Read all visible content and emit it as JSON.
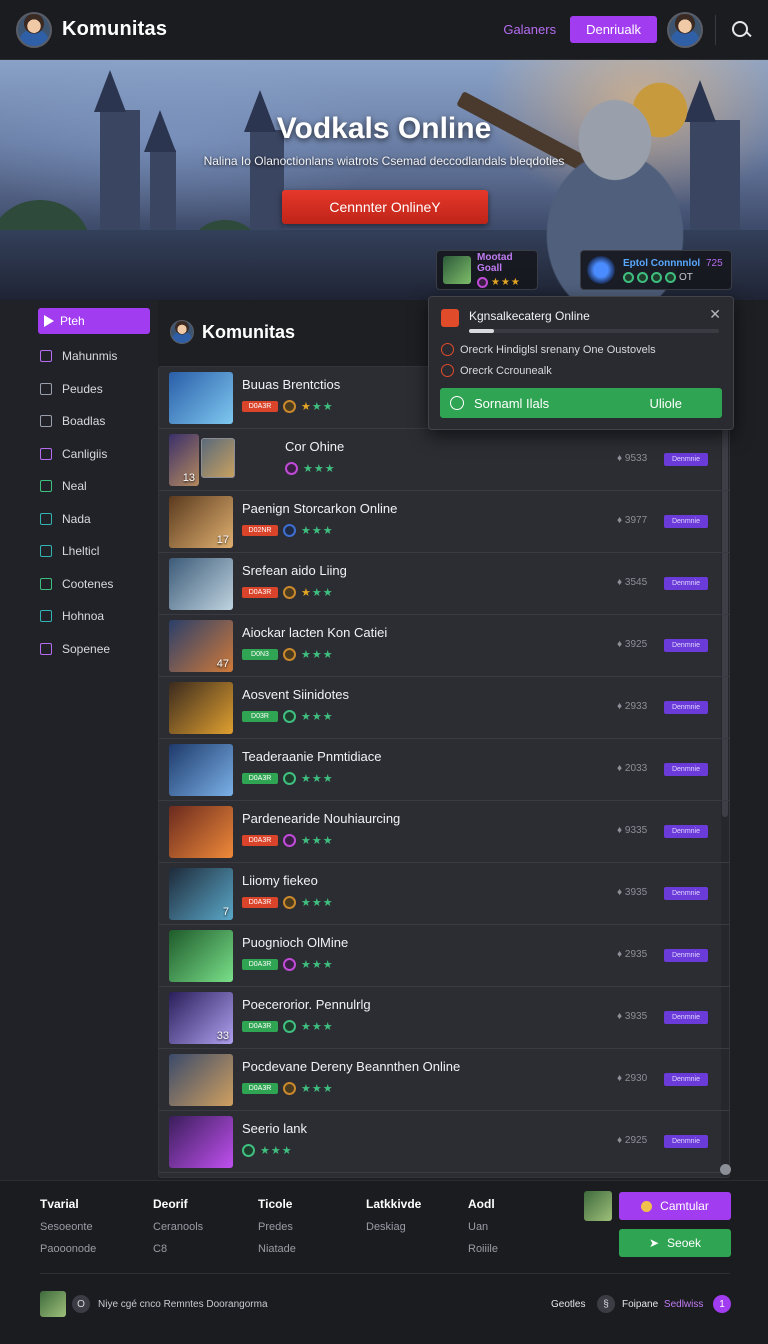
{
  "header": {
    "brand": "Komunitas",
    "link": "Galaners",
    "button": "Denriualk"
  },
  "hero": {
    "title": "Vodkals Online",
    "subtitle": "Nalina Io Olanoctionlans wiatrots Csemad deccodlandals bleqdoties",
    "cta": "Cennnter OnlineY",
    "mini_cards": [
      {
        "title": "Mootad Goall",
        "meta": "★★★"
      },
      {
        "title": "Eptol Connnnlol",
        "count": "725",
        "meta": "OT"
      }
    ]
  },
  "sidebar": {
    "items": [
      {
        "label": "Pteh",
        "icon": "play-icon",
        "active": true
      },
      {
        "label": "Mahunmis",
        "icon": "gamepad-icon"
      },
      {
        "label": "Peudes",
        "icon": "grid-icon"
      },
      {
        "label": "Boadlas",
        "icon": "list-icon"
      },
      {
        "label": "Canligiis",
        "icon": "tag-icon"
      },
      {
        "label": "Neal",
        "icon": "home-icon"
      },
      {
        "label": "Nada",
        "icon": "store-icon"
      },
      {
        "label": "Lhelticl",
        "icon": "book-icon"
      },
      {
        "label": "Cootenes",
        "icon": "users-icon"
      },
      {
        "label": "Hohnoa",
        "icon": "folder-icon"
      },
      {
        "label": "Sopenee",
        "icon": "settings-icon"
      }
    ]
  },
  "main": {
    "title": "Komunitas"
  },
  "popup": {
    "title": "Kgnsalkecaterg Online",
    "progress": 0.1,
    "lines": [
      "Orecrk Hindiglsl srenany One Oustovels",
      "Orecrk Ccrounealk"
    ],
    "action_left": "Sornaml Ilals",
    "action_right": "Uliole"
  },
  "games": [
    {
      "title": "Buuas Brentctios",
      "tag": "D0A3R",
      "tag_color": "red",
      "badge": "orange",
      "stars_gold": 1,
      "num": "",
      "stat": "",
      "button": ""
    },
    {
      "title": "Cor Ohine",
      "tag": "",
      "tag_color": "",
      "badge": "purple",
      "stars_gold": 0,
      "num": "13",
      "stat": "♦ 9533",
      "button": "Denmnie"
    },
    {
      "title": "Paenign Storcarkon Online",
      "tag": "D02NR",
      "tag_color": "red",
      "badge": "blue",
      "stars_gold": 0,
      "num": "17",
      "stat": "♦ 3977",
      "button": "Denmnie"
    },
    {
      "title": "Srefean aido Liing",
      "tag": "D0A3R",
      "tag_color": "red",
      "badge": "orange",
      "stars_gold": 1,
      "num": "",
      "stat": "♦ 3545",
      "button": "Denmnie"
    },
    {
      "title": "Aiockar lacten Kon Catiei",
      "tag": "D0N3",
      "tag_color": "green",
      "badge": "orange",
      "stars_gold": 0,
      "num": "47",
      "stat": "♦ 3925",
      "button": "Denmnie"
    },
    {
      "title": "Aosvent Siinidotes",
      "tag": "D03R",
      "tag_color": "green",
      "badge": "green",
      "stars_gold": 0,
      "num": "",
      "stat": "♦ 2933",
      "button": "Denmnie"
    },
    {
      "title": "Teaderaanie Pnmtidiace",
      "tag": "D0A3R",
      "tag_color": "green",
      "badge": "green",
      "stars_gold": 0,
      "num": "",
      "stat": "♦ 2033",
      "button": "Denmnie"
    },
    {
      "title": "Pardenearide Nouhiaurcing",
      "tag": "D0A3R",
      "tag_color": "red",
      "badge": "purple",
      "stars_gold": 0,
      "num": "",
      "stat": "♦ 9335",
      "button": "Denmnie"
    },
    {
      "title": "Liiomy fiekeo",
      "tag": "D0A3R",
      "tag_color": "red",
      "badge": "orange",
      "stars_gold": 0,
      "num": "7",
      "stat": "♦ 3935",
      "button": "Denmnie"
    },
    {
      "title": "Puognioch OlMine",
      "tag": "D0A3R",
      "tag_color": "green",
      "badge": "purple",
      "stars_gold": 0,
      "num": "",
      "stat": "♦ 2935",
      "button": "Denmnie"
    },
    {
      "title": "Poecerorior. Pennulrlg",
      "tag": "D0A3R",
      "tag_color": "green",
      "badge": "green",
      "stars_gold": 0,
      "num": "33",
      "stat": "♦ 3935",
      "button": "Denmnie"
    },
    {
      "title": "Pocdevane Dereny Beannthen Online",
      "tag": "D0A3R",
      "tag_color": "green",
      "badge": "orange",
      "stars_gold": 0,
      "num": "",
      "stat": "♦ 2930",
      "button": "Denmnie"
    },
    {
      "title": "Seerio lank",
      "tag": "",
      "tag_color": "",
      "badge": "green",
      "stars_gold": 0,
      "num": "",
      "stat": "♦ 2925",
      "button": "Denmnie"
    }
  ],
  "footer": {
    "columns": [
      {
        "head": "Tvarial",
        "items": [
          "Sesoeonte",
          "Paooonode"
        ]
      },
      {
        "head": "Deorif",
        "items": [
          "Ceranools",
          "C8"
        ]
      },
      {
        "head": "Ticole",
        "items": [
          "Predes",
          "Niatade"
        ]
      },
      {
        "head": "Latkkivde",
        "items": [
          "Deskiag"
        ]
      },
      {
        "head": "Aodl",
        "items": [
          "Uan",
          "Roiiile"
        ]
      }
    ],
    "button_primary": "Camtular",
    "button_secondary": "Seoek",
    "bottom_text": "Niye cgé cnco Remntes Doorangorma",
    "bottom_circle": "O",
    "right_label_1": "Geotles",
    "right_label_2": "Foipane",
    "right_highlight": "Sedlwiss",
    "right_badge": "1"
  },
  "colors": {
    "accent_purple": "#a23cf0",
    "accent_green": "#2fa452",
    "accent_red": "#e04b2a",
    "background": "#1e1f23"
  }
}
